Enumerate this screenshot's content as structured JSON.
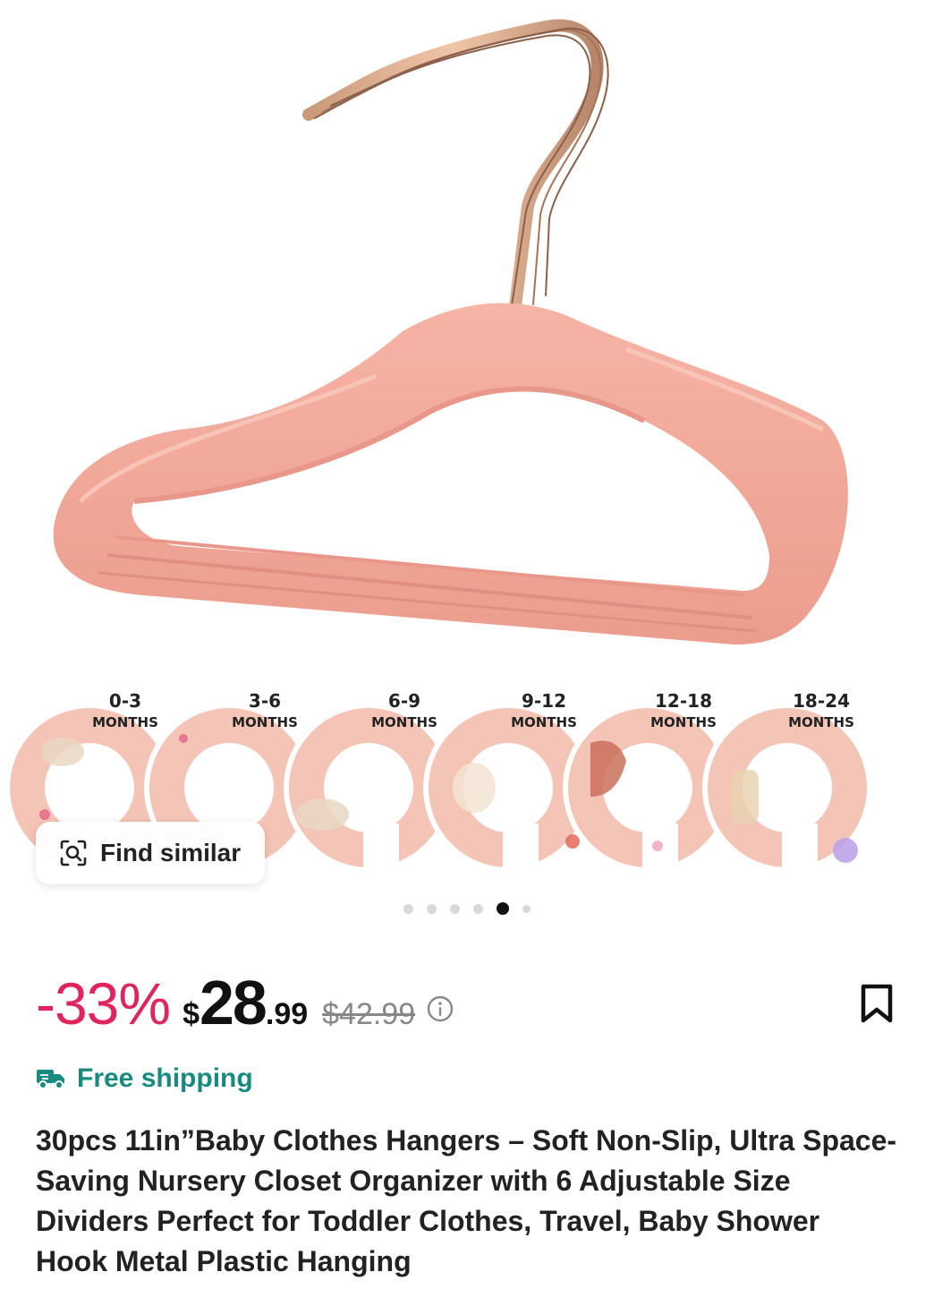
{
  "product": {
    "image_alt": "Pink velvet baby hangers with rose gold hooks and six size divider rings",
    "size_dividers": [
      {
        "range": "0-3",
        "unit": "MONTHS"
      },
      {
        "range": "3-6",
        "unit": "MONTHS"
      },
      {
        "range": "6-9",
        "unit": "MONTHS"
      },
      {
        "range": "9-12",
        "unit": "MONTHS"
      },
      {
        "range": "12-18",
        "unit": "MONTHS"
      },
      {
        "range": "18-24",
        "unit": "MONTHS"
      }
    ]
  },
  "find_similar": {
    "label": "Find similar",
    "icon": "image-search-icon"
  },
  "carousel": {
    "total": 6,
    "active_index": 4
  },
  "price": {
    "discount": "-33%",
    "currency": "$",
    "integer": "28",
    "cents": ".99",
    "original": "$42.99",
    "info_icon": "info-icon"
  },
  "bookmark_icon": "bookmark-icon",
  "shipping": {
    "label": "Free shipping",
    "icon": "truck-icon",
    "color": "#198a7f"
  },
  "title": "30pcs 11in”Baby Clothes Hangers – Soft Non-Slip, Ultra Space-Saving Nursery Closet Organizer with 6 Adjustable Size Dividers Perfect for Toddler Clothes, Travel, Baby Shower Hook Metal Plastic Hanging",
  "colors": {
    "discount": "#e0245e",
    "hanger": "#f2a89a",
    "divider": "#f4c4b6"
  }
}
